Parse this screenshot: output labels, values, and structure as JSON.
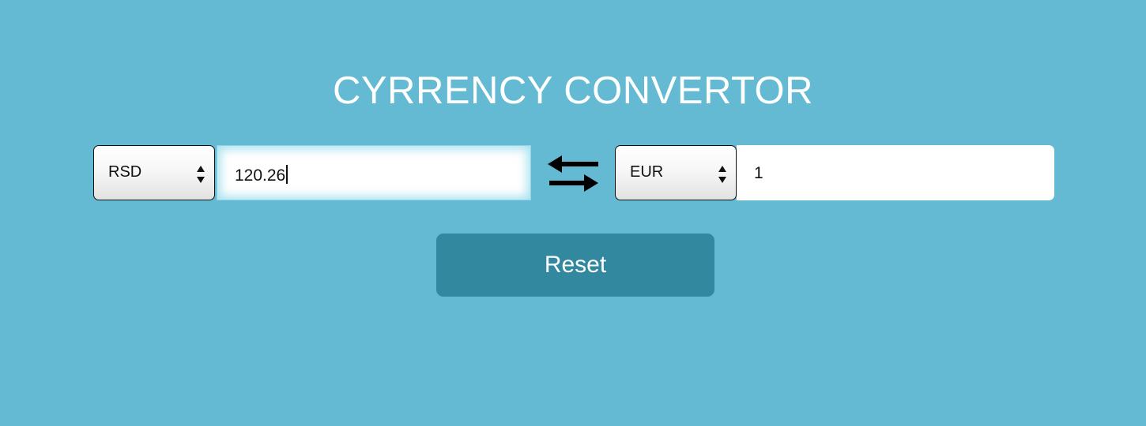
{
  "header": {
    "title": "CYRRENCY CONVERTOR"
  },
  "converter": {
    "from": {
      "currency": "RSD",
      "amount": "120.26"
    },
    "to": {
      "currency": "EUR",
      "amount": "1"
    },
    "swap_icon": "swap-arrows-icon"
  },
  "actions": {
    "reset_label": "Reset"
  },
  "colors": {
    "background": "#63bad2",
    "button": "#31889f",
    "text_light": "#ffffff"
  }
}
